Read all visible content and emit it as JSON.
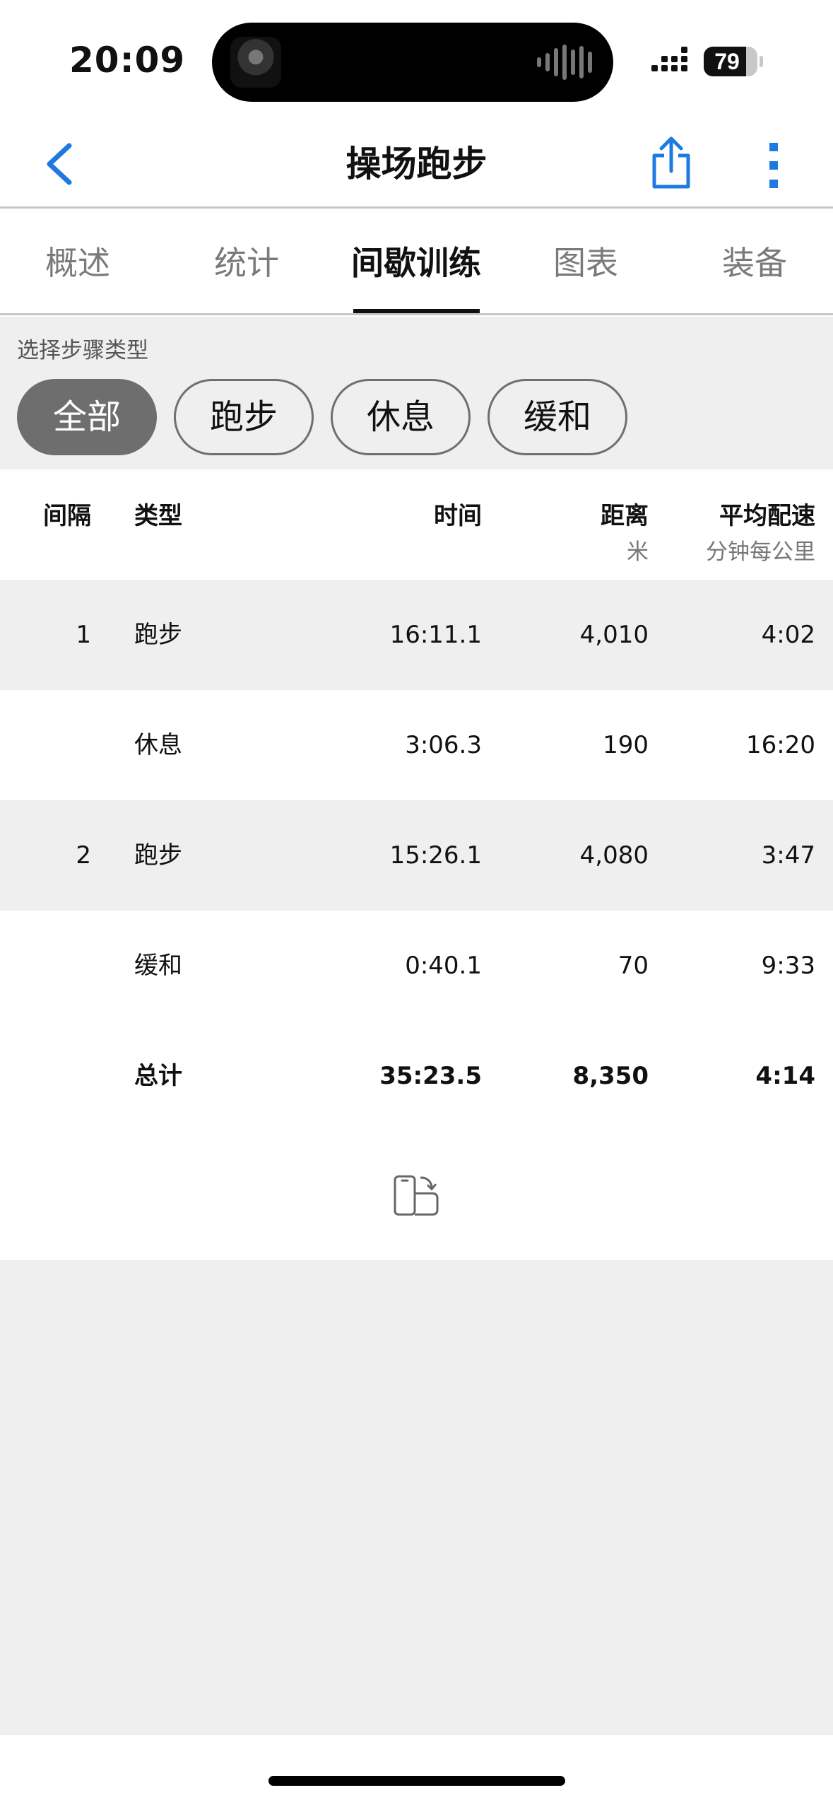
{
  "status_bar": {
    "time": "20:09",
    "battery": "79",
    "battery_level": 0.79
  },
  "nav": {
    "title": "操场跑步",
    "back_icon": "chevron-left-icon",
    "share_icon": "share-icon",
    "more_icon": "more-vertical-icon",
    "accent": "#1f7ae0"
  },
  "tabs": [
    {
      "label": "概述"
    },
    {
      "label": "统计"
    },
    {
      "label": "间歇训练"
    },
    {
      "label": "图表"
    },
    {
      "label": "装备"
    }
  ],
  "active_tab": "间歇训练",
  "filter": {
    "label": "选择步骤类型",
    "chips": [
      {
        "label": "全部"
      },
      {
        "label": "跑步"
      },
      {
        "label": "休息"
      },
      {
        "label": "缓和"
      }
    ],
    "selected": "全部"
  },
  "table": {
    "headers": {
      "interval": "间隔",
      "type": "类型",
      "time": "时间",
      "distance": "距离",
      "distance_unit": "米",
      "pace": "平均配速",
      "pace_unit": "分钟每公里"
    },
    "rows": [
      {
        "interval": "1",
        "type": "跑步",
        "time": "16:11.1",
        "distance": "4,010",
        "pace": "4:02"
      },
      {
        "interval": "",
        "type": "休息",
        "time": "3:06.3",
        "distance": "190",
        "pace": "16:20"
      },
      {
        "interval": "2",
        "type": "跑步",
        "time": "15:26.1",
        "distance": "4,080",
        "pace": "3:47"
      },
      {
        "interval": "",
        "type": "缓和",
        "time": "0:40.1",
        "distance": "70",
        "pace": "9:33"
      }
    ],
    "total": {
      "type": "总计",
      "time": "35:23.5",
      "distance": "8,350",
      "pace": "4:14"
    }
  },
  "rotate_icon": "rotate-device-icon"
}
